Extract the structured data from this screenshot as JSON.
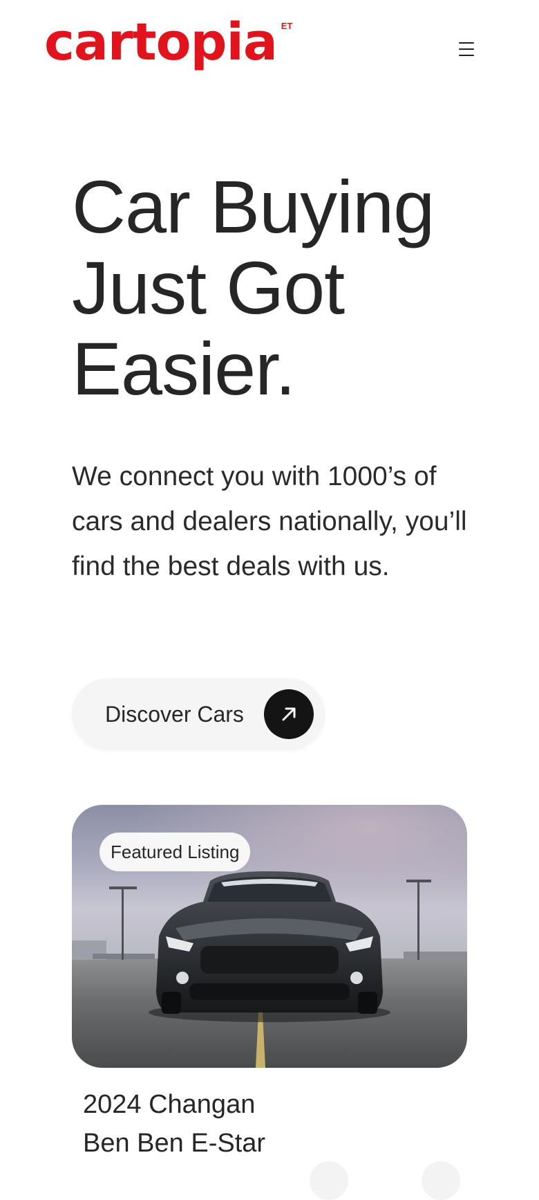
{
  "header": {
    "logo_text": "cartopia",
    "logo_superscript": "ET",
    "menu_icon": "hamburger-menu-icon"
  },
  "hero": {
    "title_line1": "Car Buying",
    "title_line2": "Just Got",
    "title_line3": "Easier.",
    "subtitle": "We connect you with 1000’s of cars and dealers nationally, you’ll find the best deals with us."
  },
  "cta": {
    "label": "Discover Cars",
    "icon": "arrow-up-right-icon"
  },
  "featured": {
    "badge": "Featured Listing",
    "image_subject": "dark grey sports car on parking deck",
    "listing_title_line1": "2024 Changan",
    "listing_title_line2": "Ben Ben E-Star"
  },
  "colors": {
    "brand": "#e1141d",
    "text": "#262626",
    "cta_background": "#f5f5f5",
    "cta_icon_background": "#141414"
  }
}
